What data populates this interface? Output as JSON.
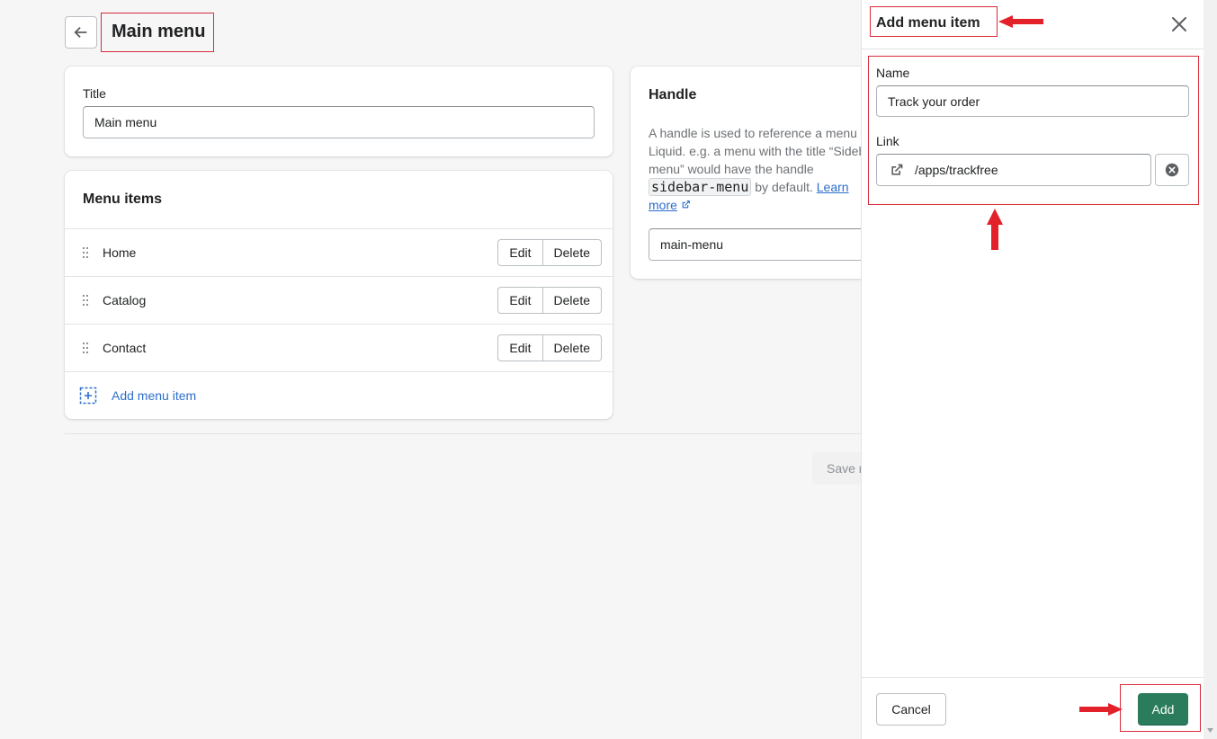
{
  "header": {
    "title": "Main menu"
  },
  "title_card": {
    "label": "Title",
    "value": "Main menu"
  },
  "menu_items": {
    "heading": "Menu items",
    "items": [
      {
        "label": "Home",
        "edit": "Edit",
        "delete": "Delete"
      },
      {
        "label": "Catalog",
        "edit": "Edit",
        "delete": "Delete"
      },
      {
        "label": "Contact",
        "edit": "Edit",
        "delete": "Delete"
      }
    ],
    "add_label": "Add menu item"
  },
  "handle_card": {
    "heading": "Handle",
    "desc_part1": "A handle is used to reference a menu",
    "desc_part2": "Liquid. e.g. a menu with the title “Sideb",
    "desc_part3": "menu” would have the handle",
    "code": "sidebar-menu",
    "desc_part4": " by default. ",
    "learn": "Learn",
    "more": "more",
    "value": "main-menu"
  },
  "save_label": "Save r",
  "panel": {
    "title": "Add menu item",
    "name_label": "Name",
    "name_value": "Track your order",
    "link_label": "Link",
    "link_value": "/apps/trackfree",
    "cancel": "Cancel",
    "add": "Add"
  },
  "colors": {
    "primary": "#2a7c5c",
    "link": "#2c6ecb",
    "annotation": "#e3212b"
  }
}
